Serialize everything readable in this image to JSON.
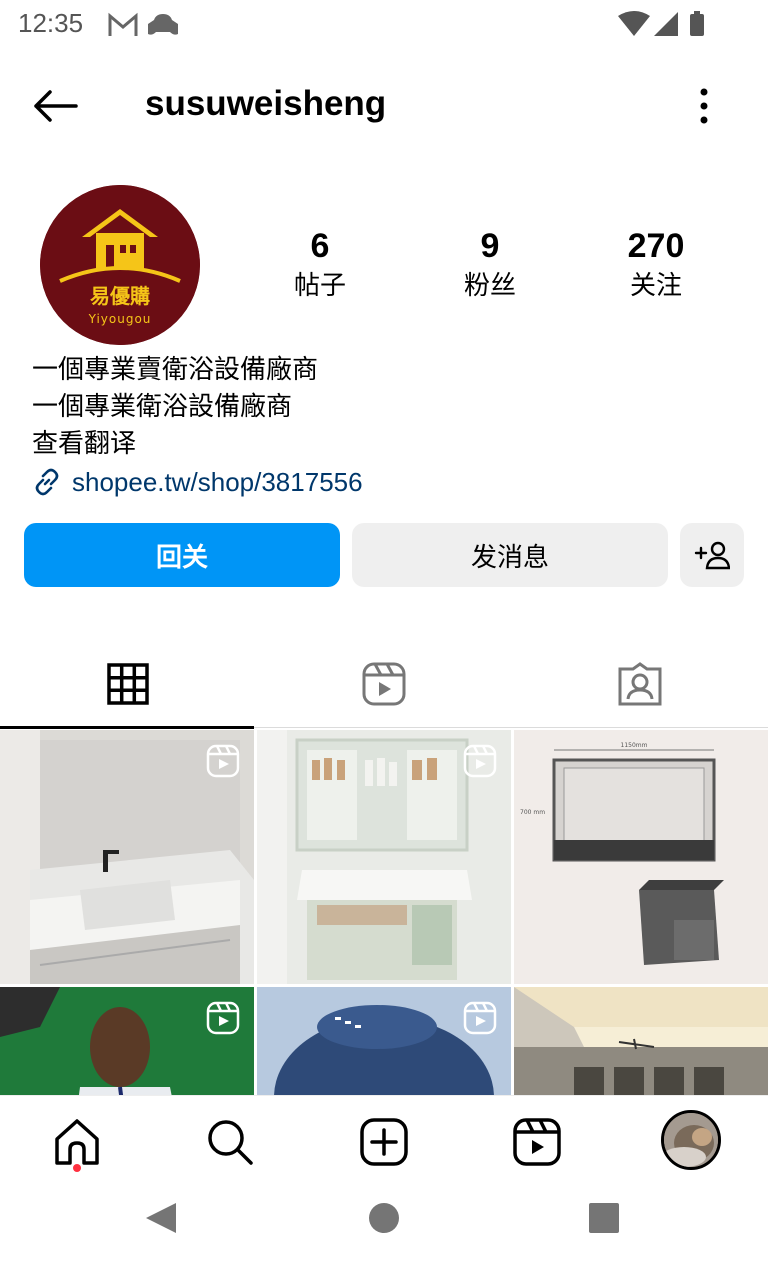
{
  "status_bar": {
    "time": "12:35"
  },
  "header": {
    "username": "susuweisheng"
  },
  "profile": {
    "avatar_text_cn": "易優購",
    "avatar_text_en": "Yiyougou",
    "stats": [
      {
        "value": "6",
        "label": "帖子"
      },
      {
        "value": "9",
        "label": "粉丝"
      },
      {
        "value": "270",
        "label": "关注"
      }
    ],
    "bio": {
      "line1": "一個專業賣衛浴設備廠商",
      "line2": "一個專業衛浴設備廠商",
      "translate": "查看翻译"
    },
    "link": "shopee.tw/shop/3817556"
  },
  "actions": {
    "follow_label": "回关",
    "message_label": "发消息"
  },
  "colors": {
    "primary": "#0095f6",
    "link": "#00376b",
    "avatar_bg": "#6b0d14",
    "logo_yellow": "#f5c518"
  },
  "grid_labels": {
    "cabinet_width": "1150mm",
    "cabinet_height": "700 mm"
  }
}
